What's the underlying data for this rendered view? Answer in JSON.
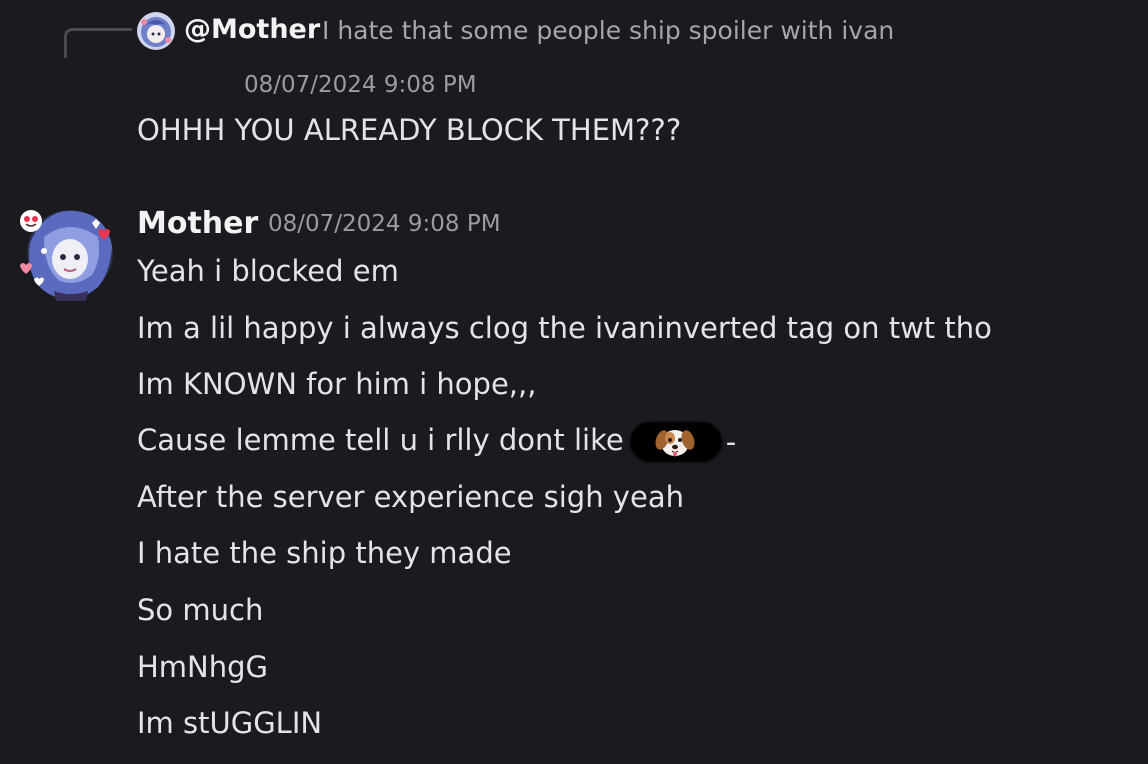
{
  "reply": {
    "author": "@Mother",
    "text": "I hate that some people ship spoiler with ivan"
  },
  "continuation": {
    "timestamp": "08/07/2024 9:08 PM",
    "text": "OHHH YOU ALREADY BLOCK THEM???"
  },
  "message": {
    "author": "Mother",
    "timestamp": "08/07/2024 9:08 PM",
    "lines": [
      "Yeah i blocked em",
      "Im a lil happy i always clog the ivaninverted tag on twt tho",
      "Im KNOWN for him i hope,,,",
      "Cause lemme tell u i rlly dont like",
      "After the server experience sigh yeah",
      "I hate the ship they made",
      "So much",
      "HmNhgG",
      "Im stUGGLIN"
    ],
    "line3_suffix": "-",
    "redacted_emoji": "dog-face-emoji"
  },
  "colors": {
    "background": "#1a1a1f",
    "author": "#f2f3f5",
    "message_text": "#e3e4e8",
    "timestamp": "#9a9ca3",
    "reply_text": "#a3a6ad"
  }
}
